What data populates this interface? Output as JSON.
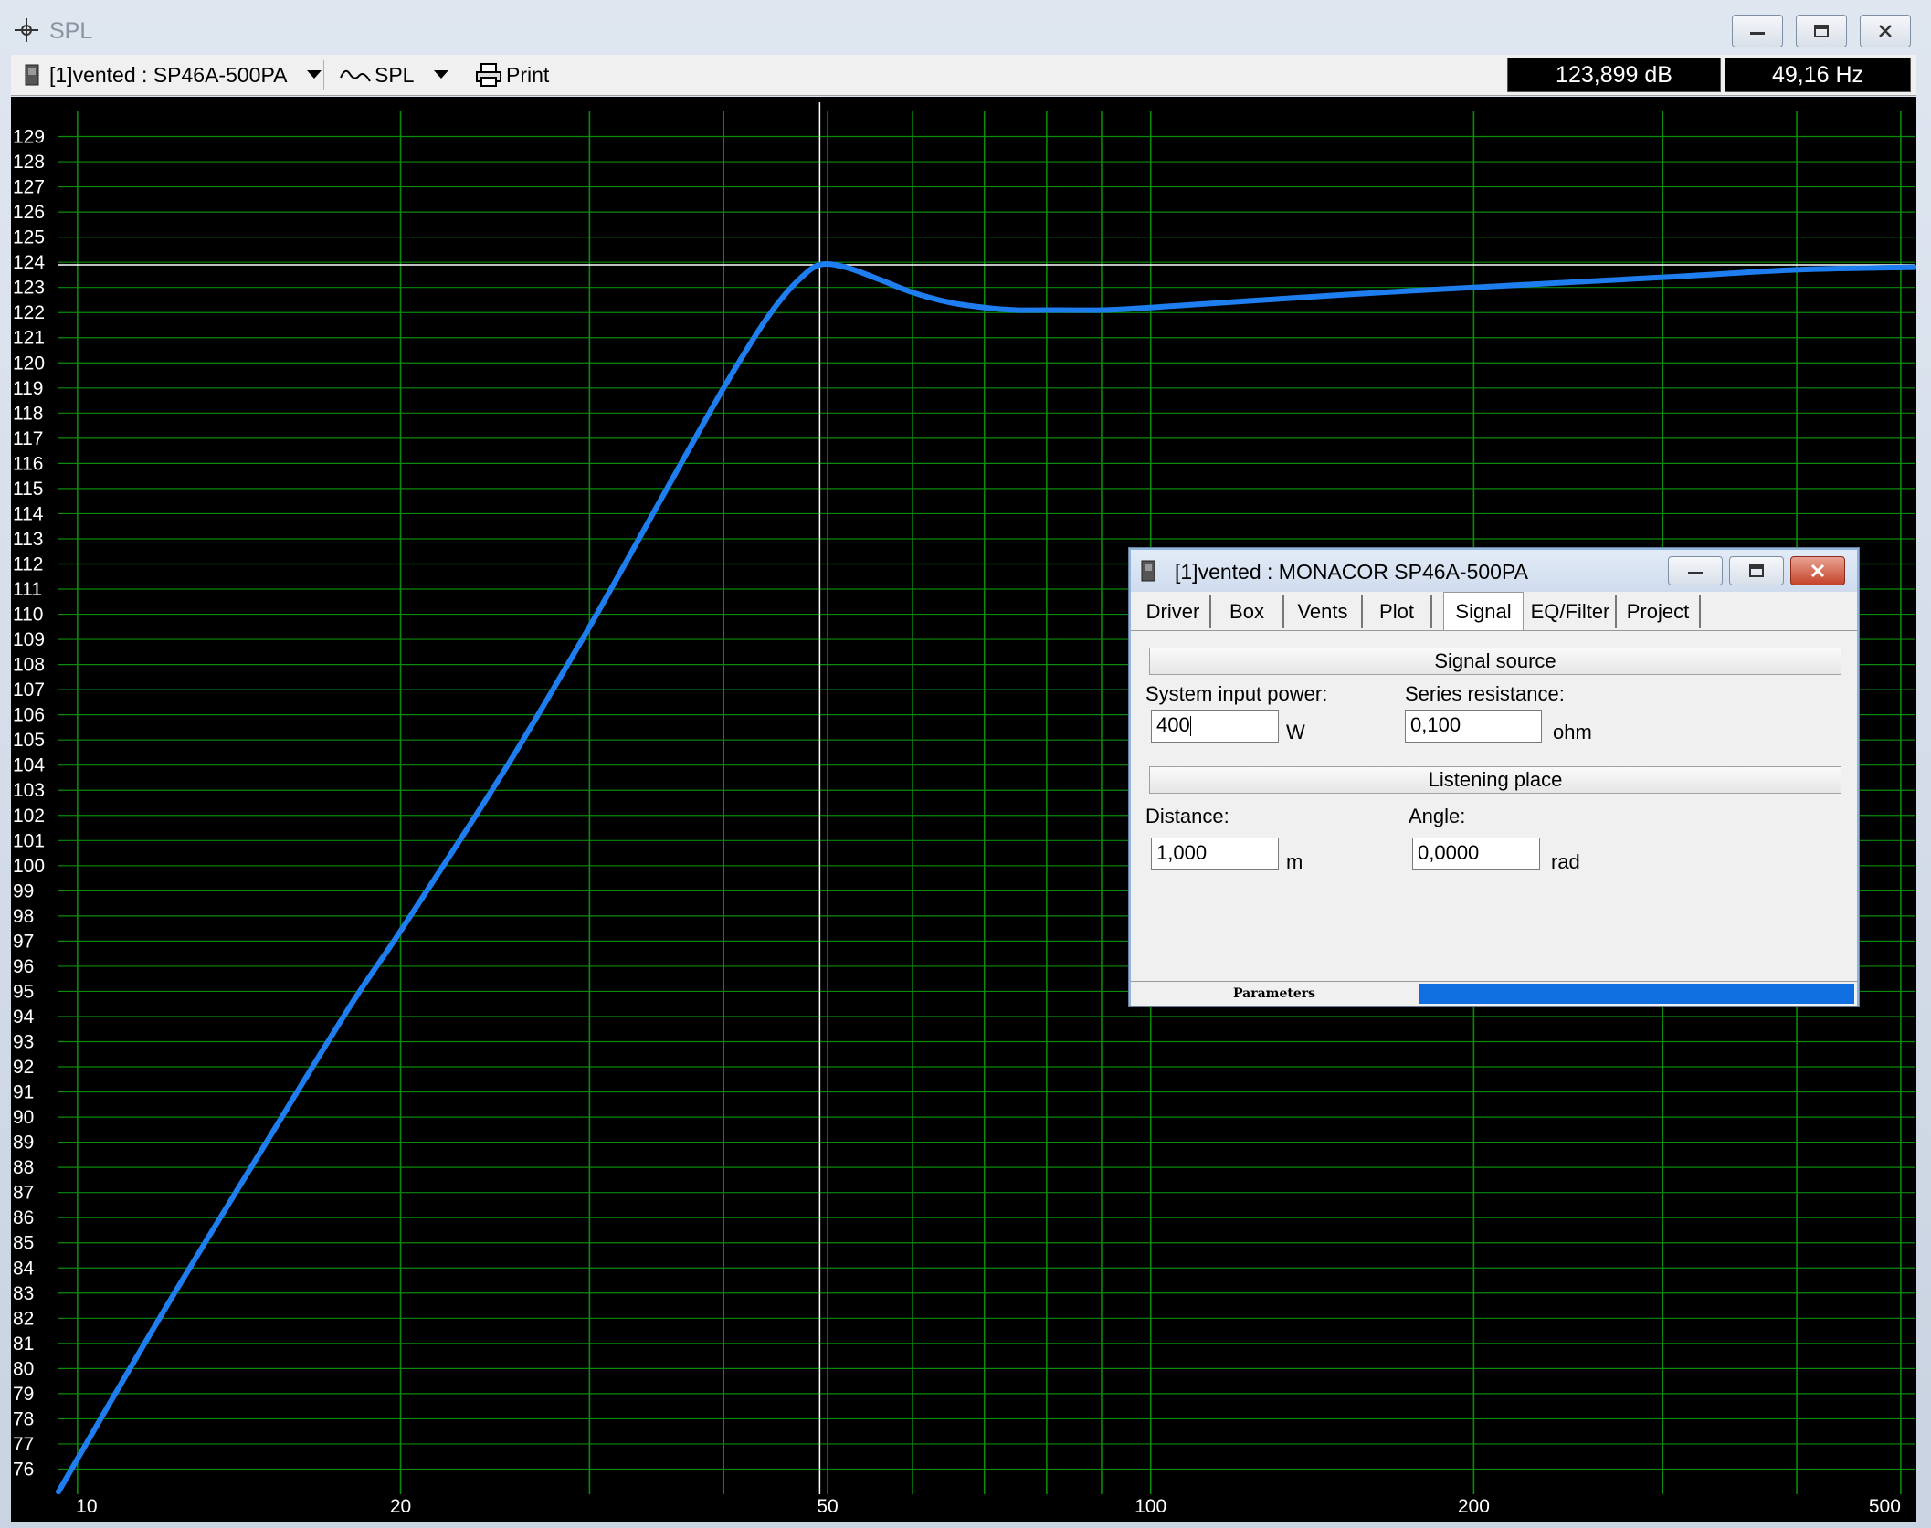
{
  "window": {
    "title": "SPL"
  },
  "toolbar": {
    "project_dropdown": "[1]vented : SP46A-500PA",
    "mode_dropdown": "SPL",
    "print_label": "Print",
    "readout_db": "123,899 dB",
    "readout_hz": "49,16 Hz"
  },
  "chart_data": {
    "type": "line",
    "title": "",
    "xlabel": "",
    "ylabel": "",
    "x_scale": "log",
    "xlim": [
      9.6,
      515
    ],
    "ylim": [
      75,
      130
    ],
    "x_ticks": [
      "10",
      "20",
      "50",
      "100",
      "200",
      "500"
    ],
    "y_ticks": [
      "129",
      "128",
      "127",
      "126",
      "125",
      "124",
      "123",
      "122",
      "121",
      "120",
      "119",
      "118",
      "117",
      "116",
      "115",
      "114",
      "113",
      "112",
      "111",
      "110",
      "109",
      "108",
      "107",
      "106",
      "105",
      "104",
      "103",
      "102",
      "101",
      "100",
      "99",
      "98",
      "97",
      "96",
      "95",
      "94",
      "93",
      "92",
      "91",
      "90",
      "89",
      "88",
      "87",
      "86",
      "85",
      "84",
      "83",
      "82",
      "81",
      "80",
      "79",
      "78",
      "77",
      "76"
    ],
    "grid": true,
    "grid_color": "#0b8a0b",
    "line_color": "#1e7ef0",
    "cursor": {
      "x": 49.16,
      "y": 123.899
    },
    "series": [
      {
        "x": [
          9.6,
          12,
          15,
          18,
          20,
          25,
          30,
          35,
          40,
          43,
          45,
          47,
          49.16,
          52,
          56,
          60,
          65,
          70,
          75,
          80,
          90,
          100,
          150,
          200,
          300,
          400,
          515
        ],
        "y": [
          75.1,
          82.2,
          89.0,
          94.5,
          97.4,
          103.8,
          109.5,
          114.6,
          119.0,
          121.2,
          122.4,
          123.3,
          123.9,
          123.8,
          123.3,
          122.8,
          122.4,
          122.2,
          122.1,
          122.1,
          122.1,
          122.2,
          122.7,
          123.0,
          123.4,
          123.7,
          123.8
        ]
      }
    ]
  },
  "dialog": {
    "title": "[1]vented : MONACOR SP46A-500PA",
    "tabs": [
      "Driver",
      "Box",
      "Vents",
      "Plot",
      "Signal",
      "EQ/Filter",
      "Project"
    ],
    "active_tab": "Signal",
    "signal_source_header": "Signal source",
    "input_power_label": "System input power:",
    "input_power_value": "400",
    "input_power_unit": "W",
    "series_resistance_label": "Series resistance:",
    "series_resistance_value": "0,100",
    "series_resistance_unit": "ohm",
    "listening_place_header": "Listening place",
    "distance_label": "Distance:",
    "distance_value": "1,000",
    "distance_unit": "m",
    "angle_label": "Angle:",
    "angle_value": "0,0000",
    "angle_unit": "rad",
    "status_label": "Parameters"
  }
}
